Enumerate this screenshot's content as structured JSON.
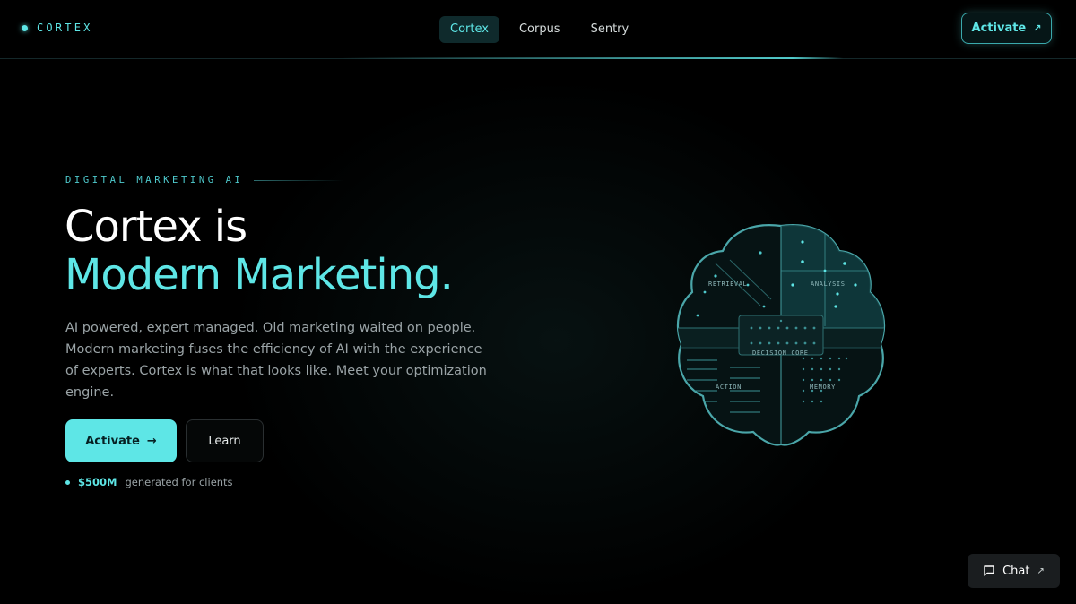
{
  "brand": {
    "name": "CORTEX"
  },
  "nav": {
    "items": [
      {
        "label": "Cortex",
        "active": true
      },
      {
        "label": "Corpus",
        "active": false
      },
      {
        "label": "Sentry",
        "active": false
      }
    ]
  },
  "header": {
    "cta_label": "Activate",
    "cta_icon": "arrow-up-right-icon"
  },
  "hero": {
    "eyebrow": "DIGITAL MARKETING AI",
    "headline_line1": "Cortex is",
    "headline_line2": "Modern Marketing.",
    "description": "AI powered, expert managed. Old marketing waited on people. Modern marketing fuses the efficiency of AI with the experience of experts. Cortex is what that looks like. Meet your optimization engine.",
    "primary_button": "Activate",
    "primary_button_arrow": "→",
    "secondary_button": "Learn",
    "stat_value": "$500M",
    "stat_label": "generated for clients"
  },
  "brain": {
    "labels": {
      "retrieval": "RETRIEVAL",
      "analysis": "ANALYSIS",
      "decision_core": "DECISION CORE",
      "action": "ACTION",
      "memory": "MEMORY"
    }
  },
  "chat": {
    "label": "Chat",
    "icon": "chat-bubble-icon"
  },
  "colors": {
    "accent": "#5ee6e6",
    "background": "#000000",
    "text_muted": "#9aa3a6"
  }
}
